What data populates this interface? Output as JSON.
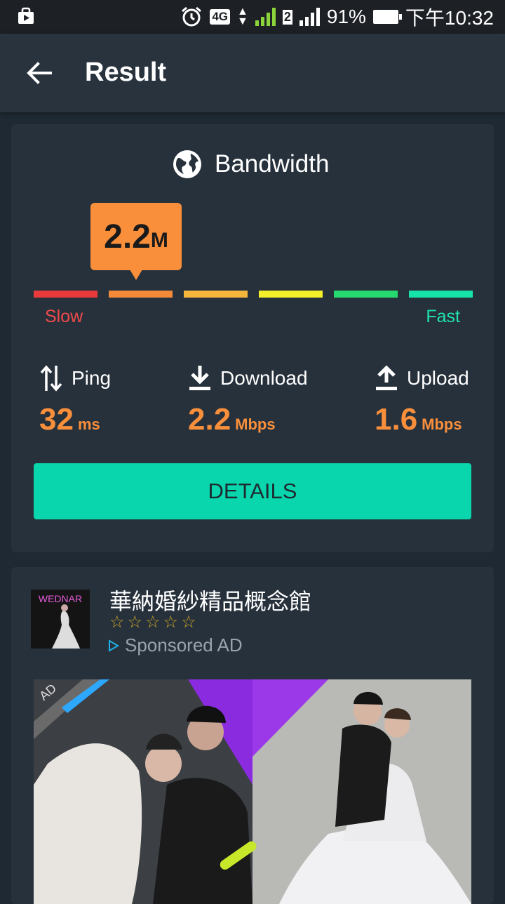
{
  "status_bar": {
    "battery": "91%",
    "network": "4G",
    "sim2": "2",
    "time": "下午10:32",
    "icons": [
      "bag-icon",
      "alarm-icon",
      "signal-icon",
      "battery-icon"
    ]
  },
  "app_bar": {
    "title": "Result"
  },
  "result": {
    "title": "Bandwidth",
    "speed_value": "2.2",
    "speed_unit": "M",
    "scale": {
      "slow_label": "Slow",
      "fast_label": "Fast",
      "colors": [
        "#e83a3a",
        "#f28a3a",
        "#f4b73b",
        "#f5ee2a",
        "#26d96f",
        "#16e3a7"
      ],
      "active_index": 1
    },
    "ping": {
      "label": "Ping",
      "value": "32",
      "unit": "ms"
    },
    "download": {
      "label": "Download",
      "value": "2.2",
      "unit": "Mbps"
    },
    "upload": {
      "label": "Upload",
      "value": "1.6",
      "unit": "Mbps"
    },
    "details_label": "DETAILS"
  },
  "ad": {
    "title": "華納婚紗精品概念館",
    "stars": "☆☆☆☆☆",
    "sponsored": "Sponsored AD",
    "logo_text": "WEDNAR",
    "image_tag": "AD"
  },
  "colors": {
    "accent": "#f98f3b",
    "button": "#09d6ad",
    "card": "#27313c",
    "background": "#1f2933"
  }
}
